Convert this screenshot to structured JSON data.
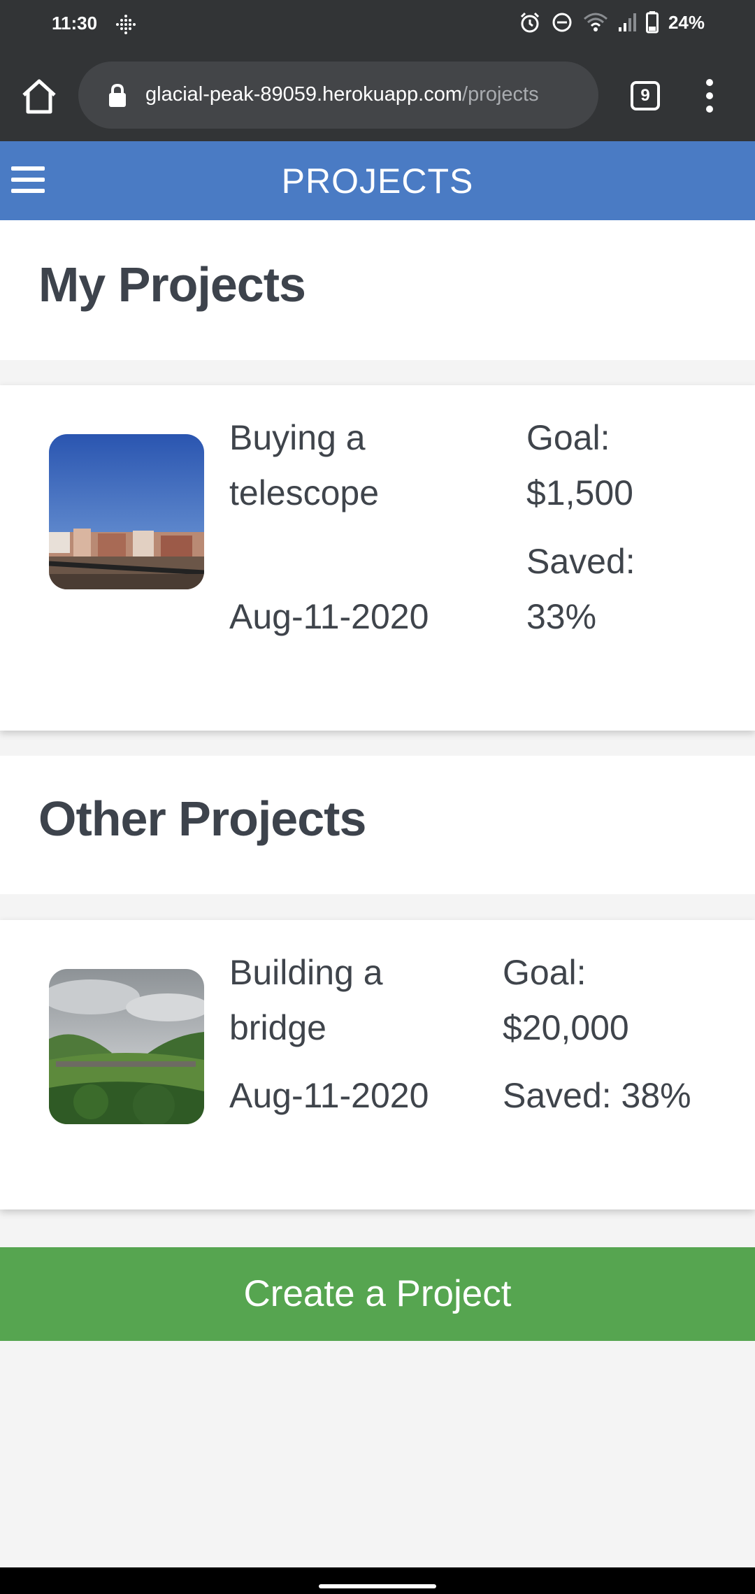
{
  "status_bar": {
    "time": "11:30",
    "battery": "24%",
    "icons": [
      "grid-icon",
      "alarm-icon",
      "do-not-disturb-icon",
      "wifi-icon",
      "signal-icon",
      "battery-icon"
    ]
  },
  "browser": {
    "url_host": "glacial-peak-89059.herokuapp.com",
    "url_path": "/projects",
    "tab_count": "9"
  },
  "header": {
    "title": "PROJECTS"
  },
  "my_projects": {
    "heading": "My Projects",
    "items": [
      {
        "name_line1": "Buying a",
        "name_line2": "telescope",
        "date": "Aug-11-2020",
        "goal_label": "Goal:",
        "goal_value": "$1,500",
        "saved_label": "Saved:",
        "saved_value": "33%"
      }
    ]
  },
  "other_projects": {
    "heading": "Other Projects",
    "items": [
      {
        "name_line1": "Building a",
        "name_line2": "bridge",
        "date": "Aug-11-2020",
        "goal_label": "Goal:",
        "goal_value": "$20,000",
        "saved": "Saved: 38%"
      }
    ]
  },
  "actions": {
    "create_label": "Create a Project"
  },
  "colors": {
    "header_blue": "#4a7bc4",
    "create_green": "#56a550",
    "browser_dark": "#323436"
  }
}
